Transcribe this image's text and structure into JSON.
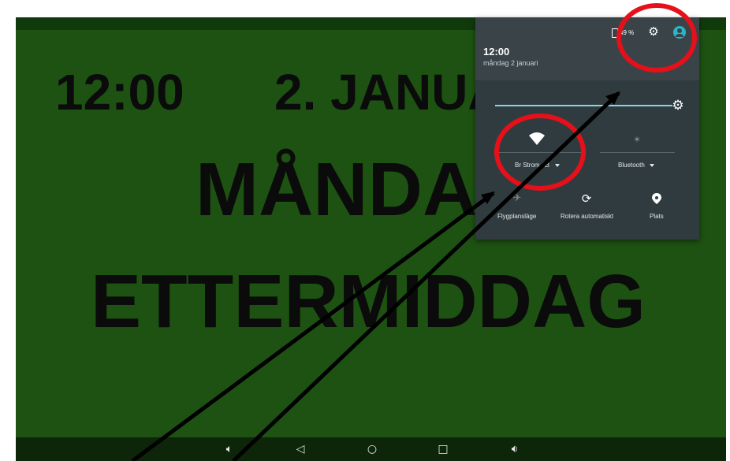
{
  "clock_screen": {
    "time": "12:00",
    "date": "2. JANUARI",
    "weekday": "MÅNDAG",
    "daypart": "ETTERMIDDAG"
  },
  "quick_settings": {
    "battery_percent": "49 %",
    "time": "12:00",
    "date": "måndag 2 januari",
    "brightness_level": 0.9,
    "tiles": {
      "wifi": {
        "label": "Br Strom AB",
        "icon": "wifi-icon"
      },
      "bluetooth": {
        "label": "Bluetooth",
        "icon": "bluetooth-icon"
      },
      "airplane": {
        "label": "Flygplansläge",
        "icon": "airplane-icon"
      },
      "rotate": {
        "label": "Rotera automatiskt",
        "icon": "rotate-icon"
      },
      "location": {
        "label": "Plats",
        "icon": "location-icon"
      }
    }
  },
  "navigation": {
    "buttons": [
      "volume-down-icon",
      "back-icon",
      "home-icon",
      "recents-icon",
      "volume-up-icon"
    ]
  },
  "colors": {
    "background": "#1d5212",
    "shade": "#303b40",
    "accent": "#2ab6c9",
    "annotation": "#e5101a"
  }
}
